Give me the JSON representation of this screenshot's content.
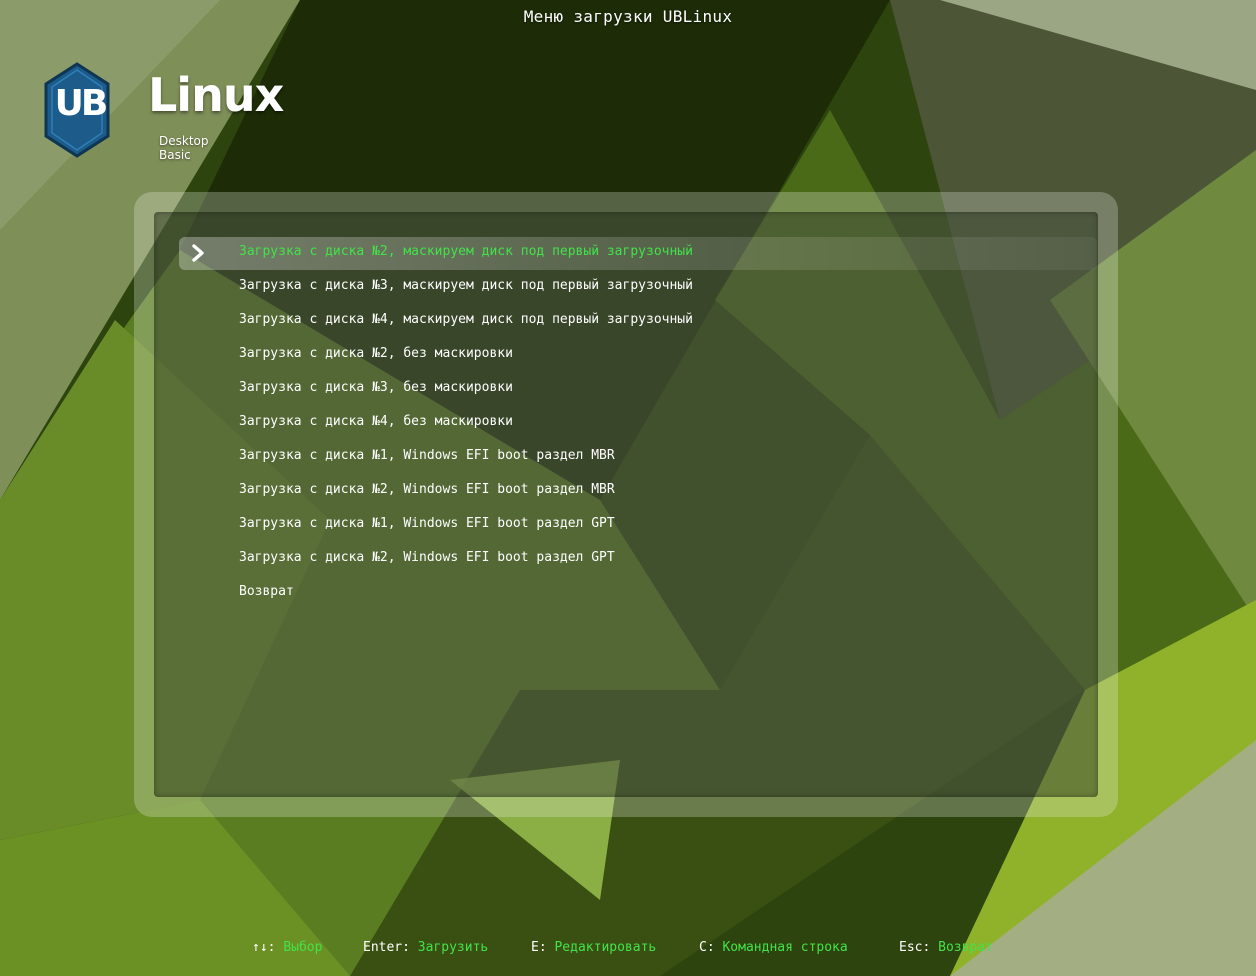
{
  "window": {
    "title": "Меню загрузки UBLinux"
  },
  "logo": {
    "badge": "UB",
    "name": "Linux",
    "edition": "Desktop Basic"
  },
  "menu": {
    "selected_index": 0,
    "entries": [
      {
        "label": "Загрузка с диска №2, маскируем диск под первый загрузочный"
      },
      {
        "label": "Загрузка с диска №3, маскируем диск под первый загрузочный"
      },
      {
        "label": "Загрузка с диска №4, маскируем диск под первый загрузочный"
      },
      {
        "label": "Загрузка с диска №2, без маскировки"
      },
      {
        "label": "Загрузка с диска №3, без маскировки"
      },
      {
        "label": "Загрузка с диска №4, без маскировки"
      },
      {
        "label": "Загрузка с диска №1, Windows EFI boot раздел MBR"
      },
      {
        "label": "Загрузка с диска №2, Windows EFI boot раздел MBR"
      },
      {
        "label": "Загрузка с диска №1, Windows EFI boot раздел GPT"
      },
      {
        "label": "Загрузка с диска №2, Windows EFI boot раздел GPT"
      },
      {
        "label": "Возврат"
      }
    ]
  },
  "footer": {
    "hints": [
      {
        "key": "↑↓:",
        "action": "Выбор"
      },
      {
        "key": "Enter:",
        "action": "Загрузить"
      },
      {
        "key": "E:",
        "action": "Редактировать"
      },
      {
        "key": "C:",
        "action": "Командная строка"
      },
      {
        "key": "Esc:",
        "action": "Возврат"
      }
    ]
  },
  "icons": {
    "selection_marker": "chevron-right-icon",
    "logo_shape": "hexagon-logo-icon"
  },
  "colors": {
    "highlight_text": "#42e24a",
    "normal_text": "#ffffff",
    "logo_hex": "#1d5c8a"
  }
}
